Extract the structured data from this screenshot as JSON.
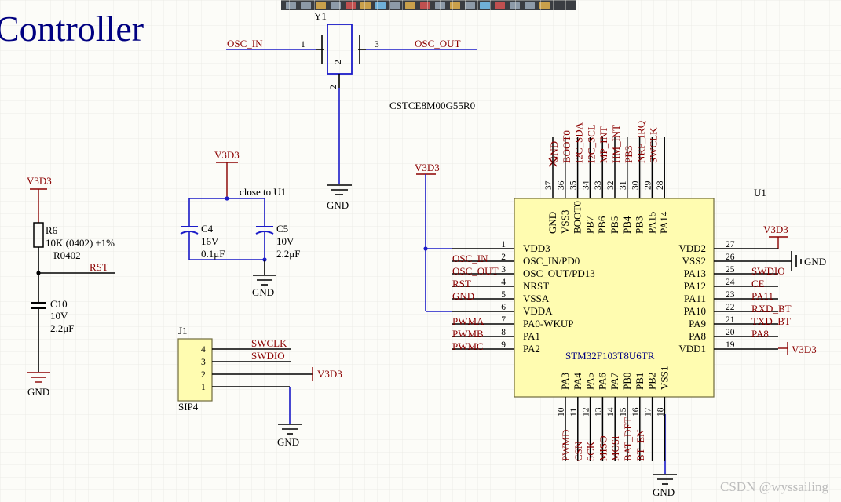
{
  "title": "Controller",
  "watermark": "CSDN @wyssailing",
  "crystal": {
    "ref": "Y1",
    "part": "CSTCE8M00G55R0",
    "pin_left": "1",
    "pin_right": "3",
    "pin_bottom": "2",
    "body_label": "2",
    "net_left": "OSC_IN",
    "net_right": "OSC_OUT",
    "gnd": "GND"
  },
  "reset": {
    "supply": "V3D3",
    "r_ref": "R6",
    "r_value": "10K (0402) ±1%",
    "r_pkg": "R0402",
    "net": "RST",
    "c_ref": "C10",
    "c_volt": "10V",
    "c_value": "2.2μF",
    "gnd": "GND"
  },
  "decoupling": {
    "supply": "V3D3",
    "note": "close to U1",
    "c4_ref": "C4",
    "c4_volt": "16V",
    "c4_value": "0.1μF",
    "c5_ref": "C5",
    "c5_volt": "10V",
    "c5_value": "2.2μF",
    "gnd": "GND"
  },
  "header": {
    "ref": "J1",
    "type": "SIP4",
    "pins": [
      "4",
      "3",
      "2",
      "1"
    ],
    "nets": [
      "SWCLK",
      "SWDIO"
    ],
    "supply": "V3D3",
    "gnd": "GND"
  },
  "mcu": {
    "ref": "U1",
    "part": "STM32F103T8U6TR",
    "supply_left": "V3D3",
    "left_pins": [
      {
        "num": "1",
        "name": "VDD3",
        "net": ""
      },
      {
        "num": "2",
        "name": "OSC_IN/PD0",
        "net": "OSC_IN"
      },
      {
        "num": "3",
        "name": "OSC_OUT/PD13",
        "net": "OSC_OUT"
      },
      {
        "num": "4",
        "name": "NRST",
        "net": "RST"
      },
      {
        "num": "5",
        "name": "VSSA",
        "net": "GND"
      },
      {
        "num": "6",
        "name": "VDDA",
        "net": ""
      },
      {
        "num": "7",
        "name": "PA0-WKUP",
        "net": "PWMA"
      },
      {
        "num": "8",
        "name": "PA1",
        "net": "PWMB"
      },
      {
        "num": "9",
        "name": "PA2",
        "net": "PWMC"
      }
    ],
    "right_pins": [
      {
        "num": "27",
        "name": "VDD2",
        "net": "V3D3"
      },
      {
        "num": "26",
        "name": "VSS2",
        "net": "GND"
      },
      {
        "num": "25",
        "name": "PA13",
        "net": "SWDIO"
      },
      {
        "num": "24",
        "name": "PA12",
        "net": "CE"
      },
      {
        "num": "23",
        "name": "PA11",
        "net": "PA11"
      },
      {
        "num": "22",
        "name": "PA10",
        "net": "RXD_BT"
      },
      {
        "num": "21",
        "name": "PA9",
        "net": "TXD_BT"
      },
      {
        "num": "20",
        "name": "PA8",
        "net": "PA8"
      },
      {
        "num": "19",
        "name": "VDD1",
        "net": "V3D3"
      }
    ],
    "top_pins": [
      {
        "num": "37",
        "name": "GND",
        "net": "GND"
      },
      {
        "num": "36",
        "name": "VSS3",
        "net": "BOOT0"
      },
      {
        "num": "35",
        "name": "BOOT0",
        "net": "I2C_SDA"
      },
      {
        "num": "34",
        "name": "PB7",
        "net": "I2C_SCL"
      },
      {
        "num": "33",
        "name": "PB6",
        "net": "MP_INT"
      },
      {
        "num": "32",
        "name": "PB5",
        "net": "HM_INT"
      },
      {
        "num": "31",
        "name": "PB4",
        "net": "PB3"
      },
      {
        "num": "30",
        "name": "PB3",
        "net": "NRF_IRQ"
      },
      {
        "num": "29",
        "name": "PA15",
        "net": "SWCLK"
      },
      {
        "num": "28",
        "name": "PA14",
        "net": ""
      }
    ],
    "bottom_pins": [
      {
        "num": "10",
        "name": "PA3",
        "net": "PWMD"
      },
      {
        "num": "11",
        "name": "PA4",
        "net": "CSN"
      },
      {
        "num": "12",
        "name": "PA5",
        "net": "SCK"
      },
      {
        "num": "13",
        "name": "PA6",
        "net": "MISO"
      },
      {
        "num": "14",
        "name": "PA7",
        "net": "MOSI"
      },
      {
        "num": "15",
        "name": "PB0",
        "net": "BAT_DET"
      },
      {
        "num": "16",
        "name": "PB1",
        "net": "BT_EN"
      },
      {
        "num": "17",
        "name": "PB2",
        "net": ""
      },
      {
        "num": "18",
        "name": "VSS1",
        "net": ""
      }
    ],
    "gnd": "GND"
  },
  "colors": {
    "wire": "#1b1bc8",
    "net_label": "#8b0000",
    "ic_body": "#fffcb0",
    "title": "#000080",
    "toolbar": "#3a3d42"
  }
}
